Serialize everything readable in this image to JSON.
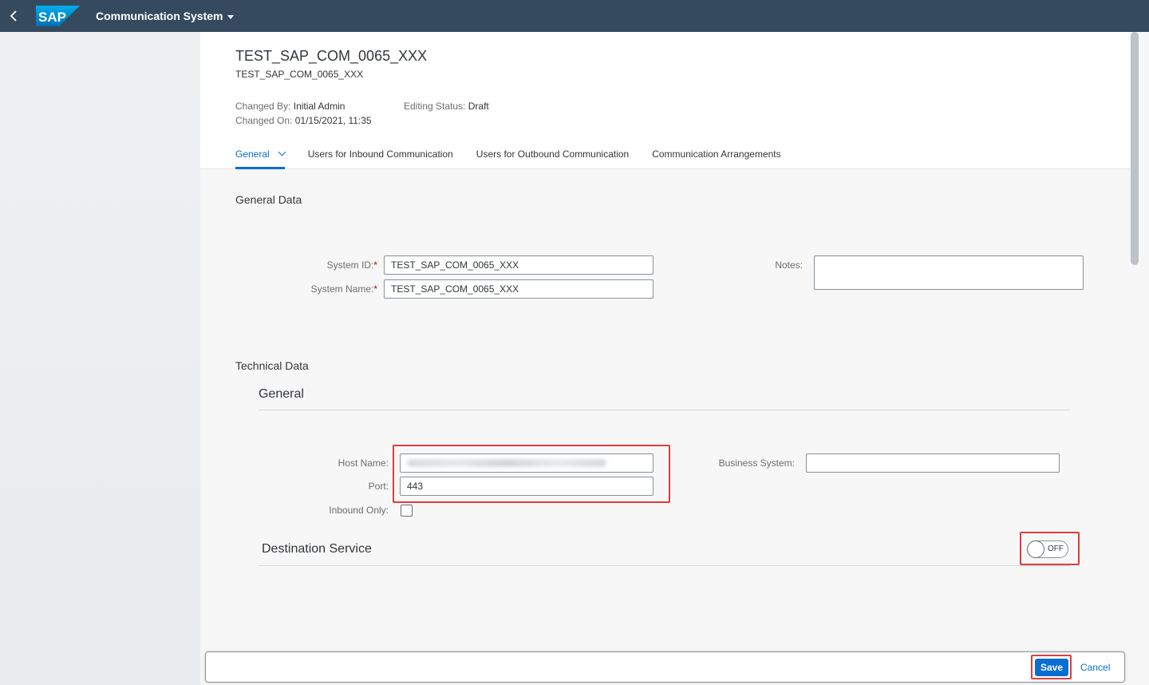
{
  "shell": {
    "app_title": "Communication System",
    "logo_text": "SAP"
  },
  "header": {
    "title": "TEST_SAP_COM_0065_XXX",
    "subtitle": "TEST_SAP_COM_0065_XXX",
    "changed_by_label": "Changed By:",
    "changed_by_value": "Initial Admin",
    "changed_on_label": "Changed On:",
    "changed_on_value": "01/15/2021, 11:35",
    "editing_status_label": "Editing Status:",
    "editing_status_value": "Draft"
  },
  "tabs": [
    {
      "label": "General"
    },
    {
      "label": "Users for Inbound Communication"
    },
    {
      "label": "Users for Outbound Communication"
    },
    {
      "label": "Communication Arrangements"
    }
  ],
  "general_data": {
    "title": "General Data",
    "system_id_label": "System ID:",
    "system_id_value": "TEST_SAP_COM_0065_XXX",
    "system_name_label": "System Name:",
    "system_name_value": "TEST_SAP_COM_0065_XXX",
    "notes_label": "Notes:",
    "required_mark": "*"
  },
  "technical_data": {
    "title": "Technical Data",
    "general_title": "General",
    "host_name_label": "Host Name:",
    "port_label": "Port:",
    "port_value": "443",
    "inbound_only_label": "Inbound Only:",
    "business_system_label": "Business System:",
    "destination_service_title": "Destination Service",
    "switch_text": "OFF"
  },
  "footer": {
    "save_label": "Save",
    "cancel_label": "Cancel"
  }
}
